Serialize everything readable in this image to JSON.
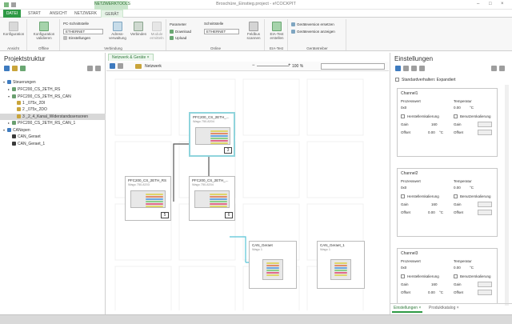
{
  "titlebar": {
    "title": "Broschüre_Einstieg.project - e!COCKPIT",
    "context_tab": "NETZWERKTOOLS",
    "minimize": "–",
    "maximize": "□",
    "close": "×"
  },
  "tabs": [
    "DATEI",
    "START",
    "ANSICHT",
    "NETZWERK",
    "GERÄT"
  ],
  "ribbon": {
    "konfiguration": "Konfiguration",
    "ansicht": "Ansicht",
    "konfiguration_validieren": "Konfiguration validieren",
    "einstellungen": "Einstellungen",
    "offline": "Offline",
    "pc_schnittstelle": "PC-Schnittstelle",
    "ethernet1": "ETHERNET",
    "adressverwaltung": "Adress-verwaltung",
    "verbinden": "Verbinden",
    "module_ermitteln": "Module ermitteln",
    "verbindung": "Verbindung",
    "parameter": "Parameter",
    "download": "Download",
    "upload": "Upload",
    "schnittstelle": "Schnittstelle",
    "ethernet2": "ETHERNET",
    "feldbus_scannen": "Feldbus scannen",
    "online": "Online",
    "eia_test": "EIA-Test erstellen",
    "eia_test_grp": "EIA-Test",
    "geraeteversion_ersetzen": "Geräteversion ersetzen",
    "geraeteversion_anzeigen": "Geräteversion anzeigen",
    "geraetetreiber": "Gerätetreiber"
  },
  "left": {
    "title": "Projektstruktur",
    "tree": [
      {
        "label": "Steuerungen",
        "indent": 1,
        "arrow": "▾",
        "color": "#3e7bbf"
      },
      {
        "label": "PFC200_CS_2ETH_RS",
        "indent": 2,
        "arrow": "▸",
        "color": "#6a9f6f"
      },
      {
        "label": "PFC200_CS_2ETH_RS_CAN",
        "indent": 2,
        "arrow": "▾",
        "color": "#6a9f6f"
      },
      {
        "label": "1 _075x_2DI",
        "indent": 3,
        "arrow": "",
        "color": "#c9a43a"
      },
      {
        "label": "2 _075x_2DO",
        "indent": 3,
        "arrow": "",
        "color": "#c9a43a"
      },
      {
        "label": "3 _2_4_Kanal_Widerstandssensoren",
        "indent": 3,
        "arrow": "",
        "color": "#c9a43a"
      },
      {
        "label": "PFC200_CS_2ETH_RS_CAN_1",
        "indent": 2,
        "arrow": "▸",
        "color": "#6a9f6f"
      },
      {
        "label": "CANopen",
        "indent": 1,
        "arrow": "▾",
        "color": "#3e7bbf"
      },
      {
        "label": "CAN_Geraet",
        "indent": 2,
        "arrow": "",
        "color": "#3a3a3a"
      },
      {
        "label": "CAN_Geraet_1",
        "indent": 2,
        "arrow": "",
        "color": "#3a3a3a"
      }
    ]
  },
  "center": {
    "doc_tab": "Netzwerk & Geräte ×",
    "breadcrumb": "Netzwerk",
    "zoom": "100 %",
    "devices": [
      {
        "name": "PFC200_CS_2ETH_...",
        "sub": "Wago 750-8204",
        "num": "3"
      },
      {
        "name": "PFC200_CS_2ETH_RS",
        "sub": "Wago 750-8203",
        "num": "5"
      },
      {
        "name": "PFC200_CS_2ETH_...",
        "sub": "Wago 750-8204",
        "num": "6"
      },
      {
        "name": "CAN_Geraet",
        "sub": "Wago 1",
        "num": ""
      },
      {
        "name": "CAN_Geraet_1",
        "sub": "Wago 1",
        "num": ""
      }
    ]
  },
  "right": {
    "title": "Einstellungen",
    "standard_label": "Standardverhalten: Expandiert",
    "channels": [
      {
        "title": "Channel1",
        "prozesswert": "Prozesswert",
        "temperatur": "Temperatur",
        "pv": "0x0",
        "temp": "0.00",
        "unit": "°C",
        "hersteller": "Herstellerskalierung",
        "benutzer": "Benutzerskalierung",
        "gain_l": "Gain",
        "gain": "160",
        "gain2": "Gain",
        "offset_l": "Offset",
        "offset": "0.00",
        "offset_unit": "°C",
        "offset2": "Offset"
      },
      {
        "title": "Channel2",
        "prozesswert": "Prozesswert",
        "temperatur": "Temperatur",
        "pv": "0x0",
        "temp": "0.00",
        "unit": "°C",
        "hersteller": "Herstellerskalierung",
        "benutzer": "Benutzerskalierung",
        "gain_l": "Gain",
        "gain": "160",
        "gain2": "Gain",
        "offset_l": "Offset",
        "offset": "0.00",
        "offset_unit": "°C",
        "offset2": "Offset"
      },
      {
        "title": "Channel3",
        "prozesswert": "Prozesswert",
        "temperatur": "Temperatur",
        "pv": "0x0",
        "temp": "0.00",
        "unit": "°C",
        "hersteller": "Herstellerskalierung",
        "benutzer": "Benutzerskalierung",
        "gain_l": "Gain",
        "gain": "160",
        "gain2": "Gain",
        "offset_l": "Offset",
        "offset": "0.00",
        "offset_unit": "°C",
        "offset2": "Offset"
      }
    ],
    "bottom_tabs": [
      "Einstellungen ×",
      "Produktkatalog ×"
    ]
  },
  "colors": {
    "accent": "#2e9a45",
    "selected_device": "#8fd4dc",
    "connector": "#58c4d6"
  }
}
